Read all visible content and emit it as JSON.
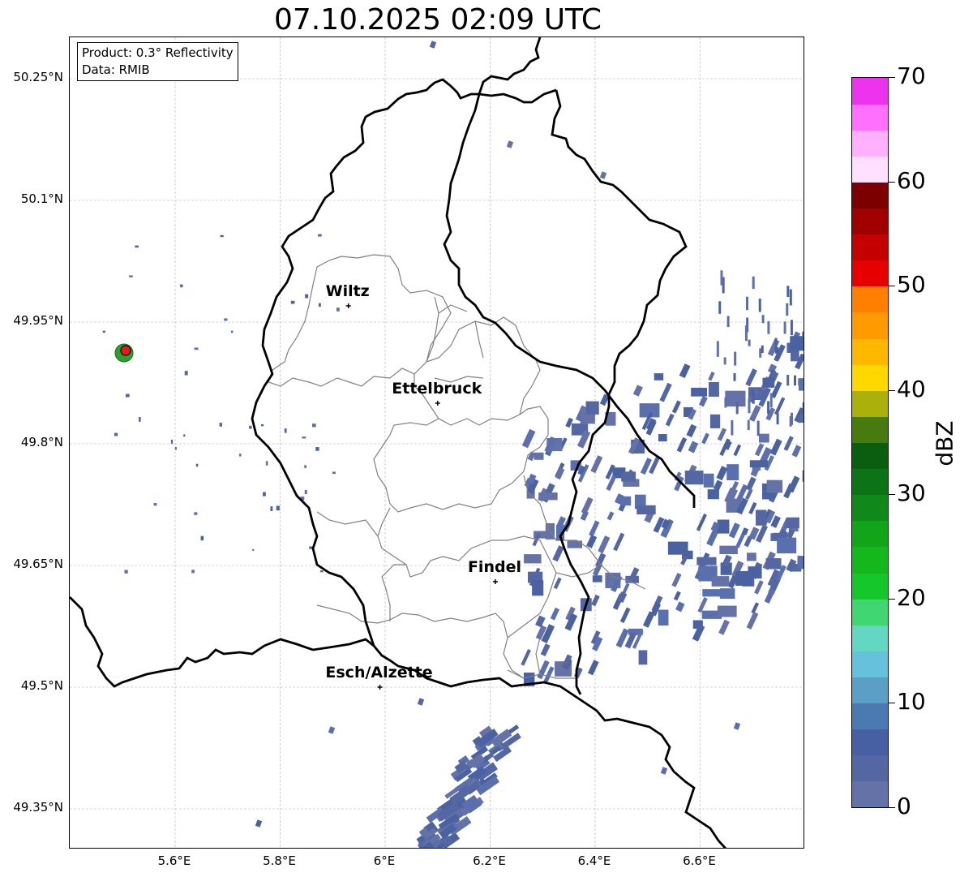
{
  "title": "07.10.2025 02:09 UTC",
  "info": {
    "product": "Product: 0.3° Reflectivity",
    "data": "Data: RMIB"
  },
  "map": {
    "lon_range": [
      5.4,
      6.8
    ],
    "lat_range": [
      49.3,
      50.3
    ],
    "lat_ticks": [
      "50.25°N",
      "50.1°N",
      "49.95°N",
      "49.8°N",
      "49.65°N",
      "49.5°N",
      "49.35°N"
    ],
    "lon_ticks": [
      "5.6°E",
      "5.8°E",
      "6°E",
      "6.2°E",
      "6.4°E",
      "6.6°E"
    ],
    "cities": [
      {
        "name": "Wiltz",
        "lon": 5.93,
        "lat": 49.97
      },
      {
        "name": "Ettelbruck",
        "lon": 6.1,
        "lat": 49.85
      },
      {
        "name": "Findel",
        "lon": 6.21,
        "lat": 49.63
      },
      {
        "name": "Esch/Alzette",
        "lon": 5.99,
        "lat": 49.5
      }
    ],
    "radar_site": {
      "lon": 5.51,
      "lat": 49.92
    },
    "gridlines": true
  },
  "colorbar": {
    "label": "dBZ",
    "ticks": [
      "0",
      "10",
      "20",
      "30",
      "40",
      "50",
      "60",
      "70"
    ],
    "range": [
      0,
      70
    ],
    "colors": [
      "#6472a8",
      "#5467a3",
      "#4660a3",
      "#4a7ab1",
      "#5b9ec6",
      "#66c1dc",
      "#63d7c2",
      "#40d671",
      "#15c72b",
      "#14b81d",
      "#12a519",
      "#10881a",
      "#0c7417",
      "#0b5e10",
      "#477b10",
      "#acb00a",
      "#ffd800",
      "#ffb800",
      "#ff9a00",
      "#ff7f00",
      "#e60000",
      "#c40000",
      "#a10000",
      "#7d0000",
      "#ffe0ff",
      "#ffb0ff",
      "#ff70ff",
      "#ee33ee"
    ]
  }
}
